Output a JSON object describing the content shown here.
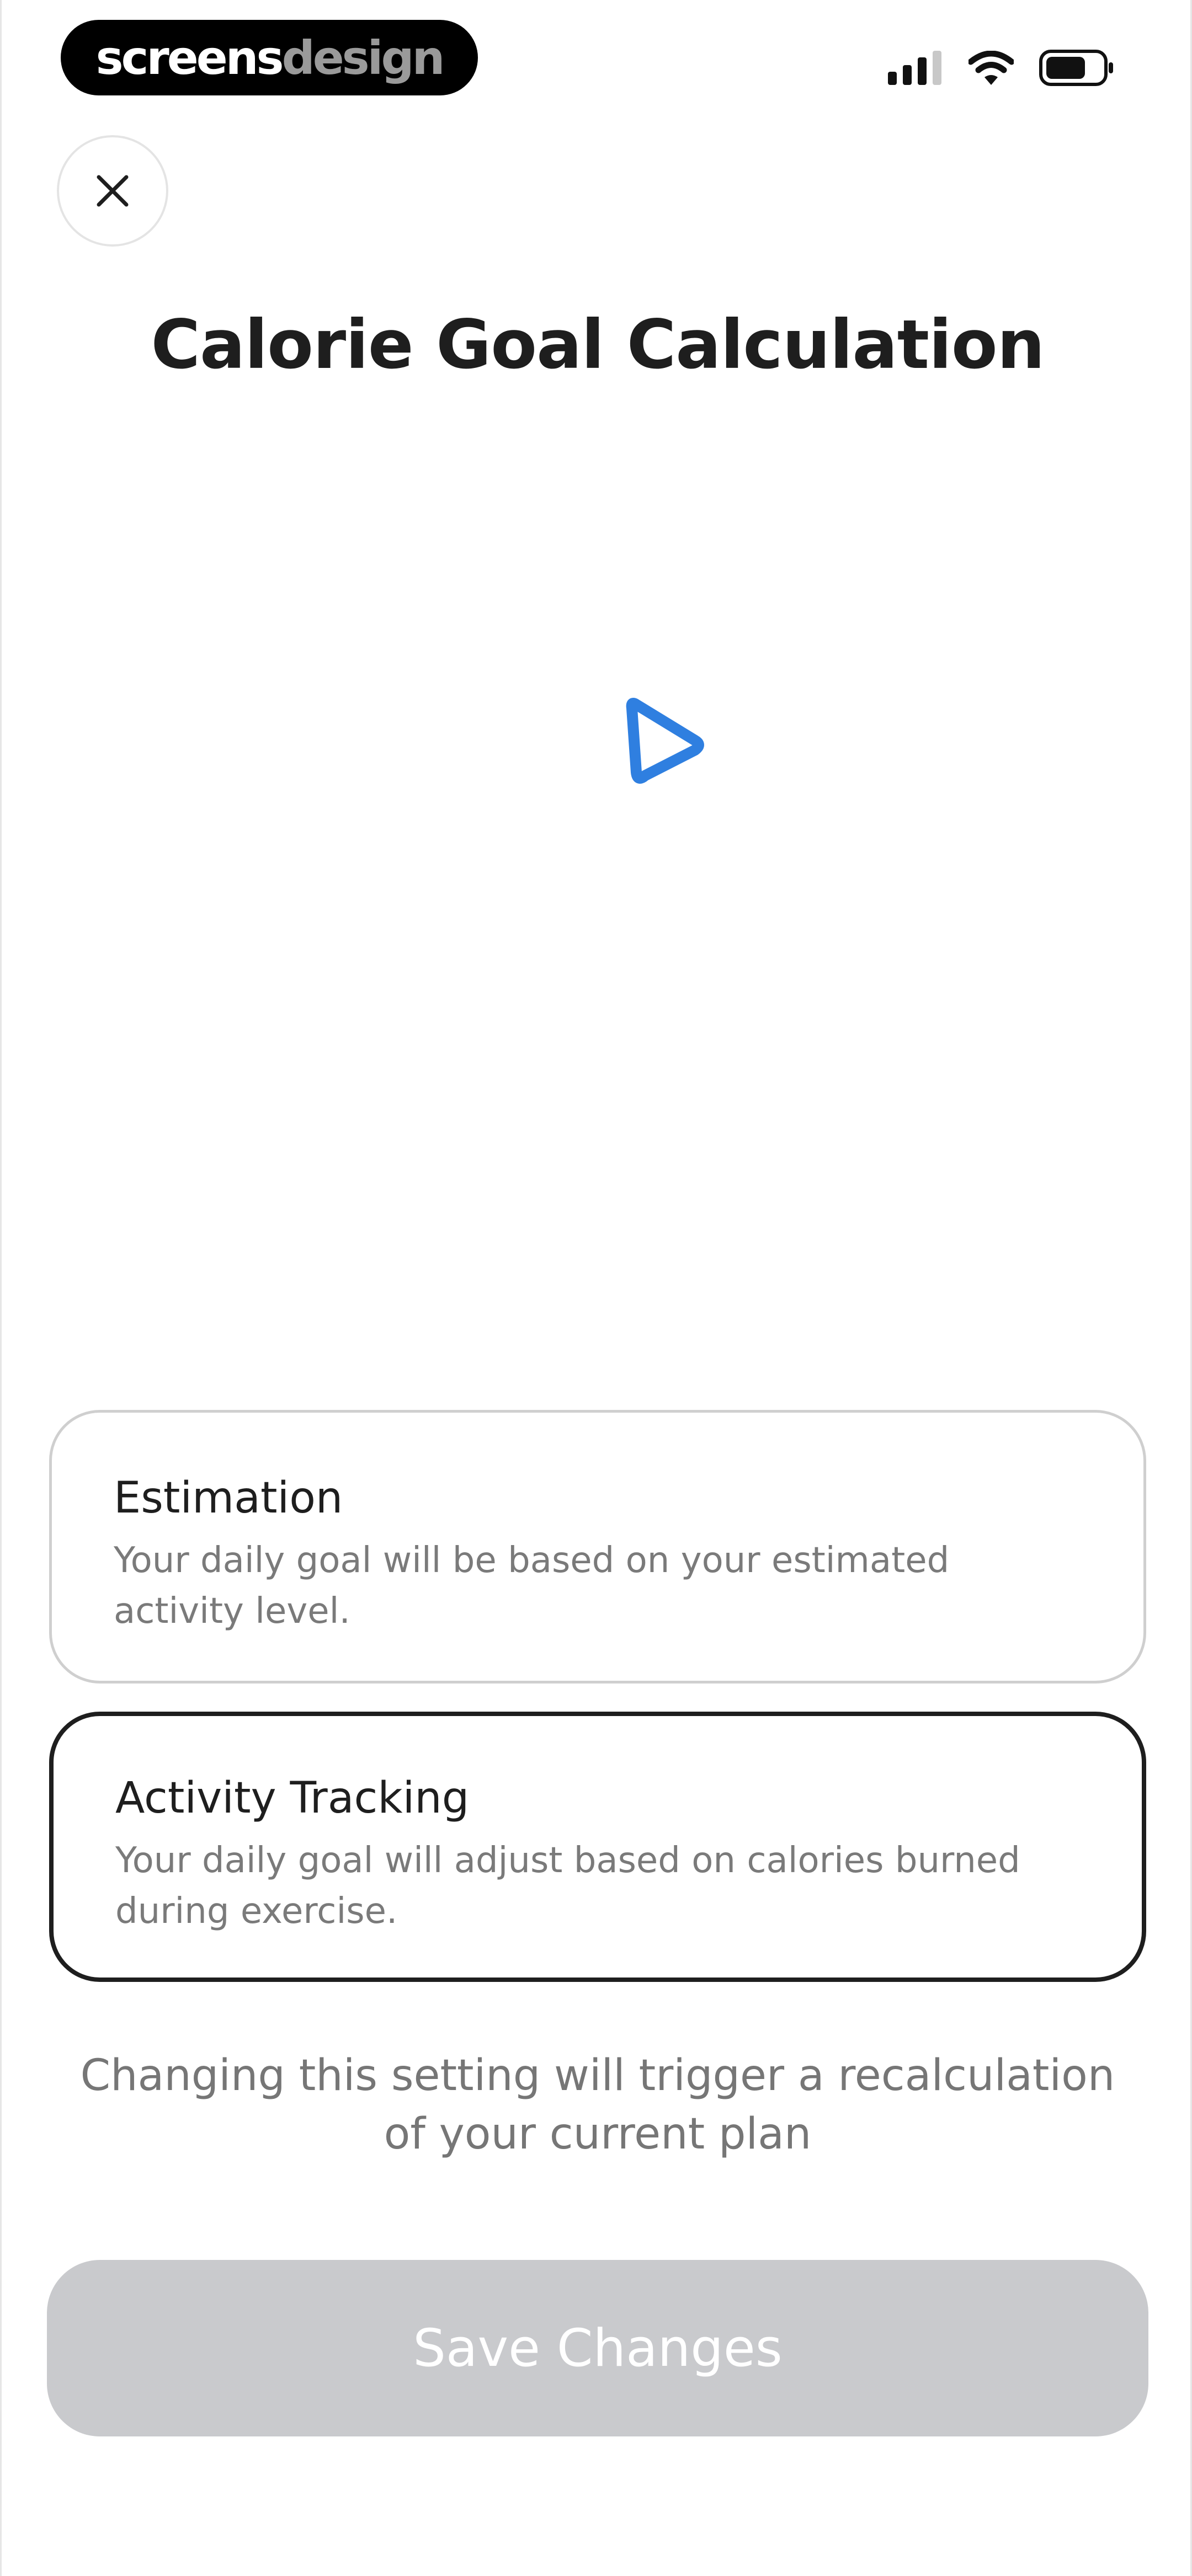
{
  "status_bar": {
    "brand_part1": "screens",
    "brand_part2": "design",
    "icons": [
      "cellular-signal-icon",
      "wifi-icon",
      "battery-icon"
    ]
  },
  "header": {
    "close_icon": "close-icon",
    "title": "Calorie Goal Calculation"
  },
  "options": [
    {
      "title": "Estimation",
      "description": "Your daily goal will be based on your estimated activity level.",
      "selected": false
    },
    {
      "title": "Activity Tracking",
      "description": "Your daily goal will adjust based on calories burned during exercise.",
      "selected": true
    }
  ],
  "note": "Changing this setting will trigger a recalculation of your current plan",
  "save_button": {
    "label": "Save Changes",
    "enabled": false
  },
  "colors": {
    "text_primary": "#1e1e1e",
    "text_secondary": "#7a7a7a",
    "selected_border": "#1e1e1e",
    "unselected_border": "#cfcfcf",
    "disabled_button": "#c9cacd",
    "cursor": "#2f7fe0"
  }
}
